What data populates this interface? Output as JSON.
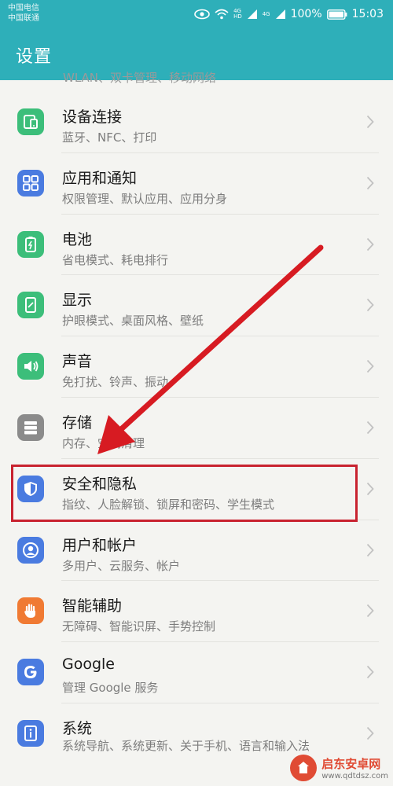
{
  "status_bar": {
    "carrier_1": "中国电信",
    "carrier_2": "中国联通",
    "net_top": "4G",
    "net_bottom": "HD",
    "net_2": "4G",
    "battery": "100%",
    "time": "15:03"
  },
  "header": {
    "title": "设置"
  },
  "peek_item": {
    "subtitle": "WLAN、双卡管理、移动网络"
  },
  "settings": [
    {
      "title": "设备连接",
      "subtitle": "蓝牙、NFC、打印",
      "icon": "devices-icon",
      "color": "#3cbe7a"
    },
    {
      "title": "应用和通知",
      "subtitle": "权限管理、默认应用、应用分身",
      "icon": "apps-grid-icon",
      "color": "#4a7be0"
    },
    {
      "title": "电池",
      "subtitle": "省电模式、耗电排行",
      "icon": "battery-icon",
      "color": "#3cbe7a"
    },
    {
      "title": "显示",
      "subtitle": "护眼模式、桌面风格、壁纸",
      "icon": "display-icon",
      "color": "#3cbe7a"
    },
    {
      "title": "声音",
      "subtitle": "免打扰、铃声、振动",
      "icon": "volume-icon",
      "color": "#3cbe7a"
    },
    {
      "title": "存储",
      "subtitle": "内存、空间清理",
      "icon": "storage-icon",
      "color": "#8b8b8b"
    },
    {
      "title": "安全和隐私",
      "subtitle": "指纹、人脸解锁、锁屏和密码、学生模式",
      "icon": "shield-icon",
      "color": "#4a7be0"
    },
    {
      "title": "用户和帐户",
      "subtitle": "多用户、云服务、帐户",
      "icon": "user-icon",
      "color": "#4a7be0"
    },
    {
      "title": "智能辅助",
      "subtitle": "无障碍、智能识屏、手势控制",
      "icon": "hand-icon",
      "color": "#f07a33"
    },
    {
      "title": "Google",
      "subtitle": "管理 Google 服务",
      "icon": "google-icon",
      "color": "#4a7be0"
    },
    {
      "title": "系统",
      "subtitle": "系统导航、系统更新、关于手机、语言和输入法",
      "icon": "info-icon",
      "color": "#4a7be0"
    }
  ],
  "watermark": {
    "name": "启东安卓网",
    "url": "www.qdtdsz.com"
  },
  "colors": {
    "header": "#2eafb9",
    "highlight": "#c8222f",
    "arrow": "#d71b22"
  }
}
